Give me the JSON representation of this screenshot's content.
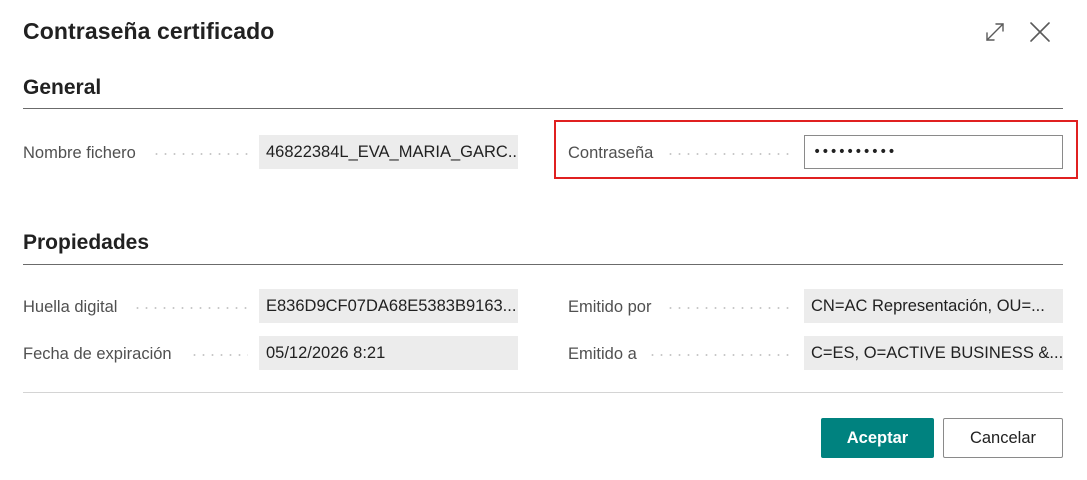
{
  "dialog": {
    "title": "Contraseña certificado",
    "expand_icon": "expand-icon",
    "close_icon": "close-icon"
  },
  "general": {
    "heading": "General",
    "fields": {
      "nombre_fichero": {
        "label": "Nombre fichero",
        "value": "46822384L_EVA_MARIA_GARC..."
      },
      "contrasena": {
        "label": "Contraseña",
        "value": "••••••••••"
      }
    }
  },
  "propiedades": {
    "heading": "Propiedades",
    "fields": {
      "huella_digital": {
        "label": "Huella digital",
        "value": "E836D9CF07DA68E5383B9163..."
      },
      "fecha_expiracion": {
        "label": "Fecha de expiración",
        "value": "05/12/2026 8:21"
      },
      "emitido_por": {
        "label": "Emitido por",
        "value": "CN=AC Representación, OU=..."
      },
      "emitido_a": {
        "label": "Emitido a",
        "value": "C=ES, O=ACTIVE BUSINESS &..."
      }
    }
  },
  "actions": {
    "accept_label": "Aceptar",
    "cancel_label": "Cancelar"
  },
  "colors": {
    "primary_button": "#00827f",
    "highlight": "#e02020"
  }
}
